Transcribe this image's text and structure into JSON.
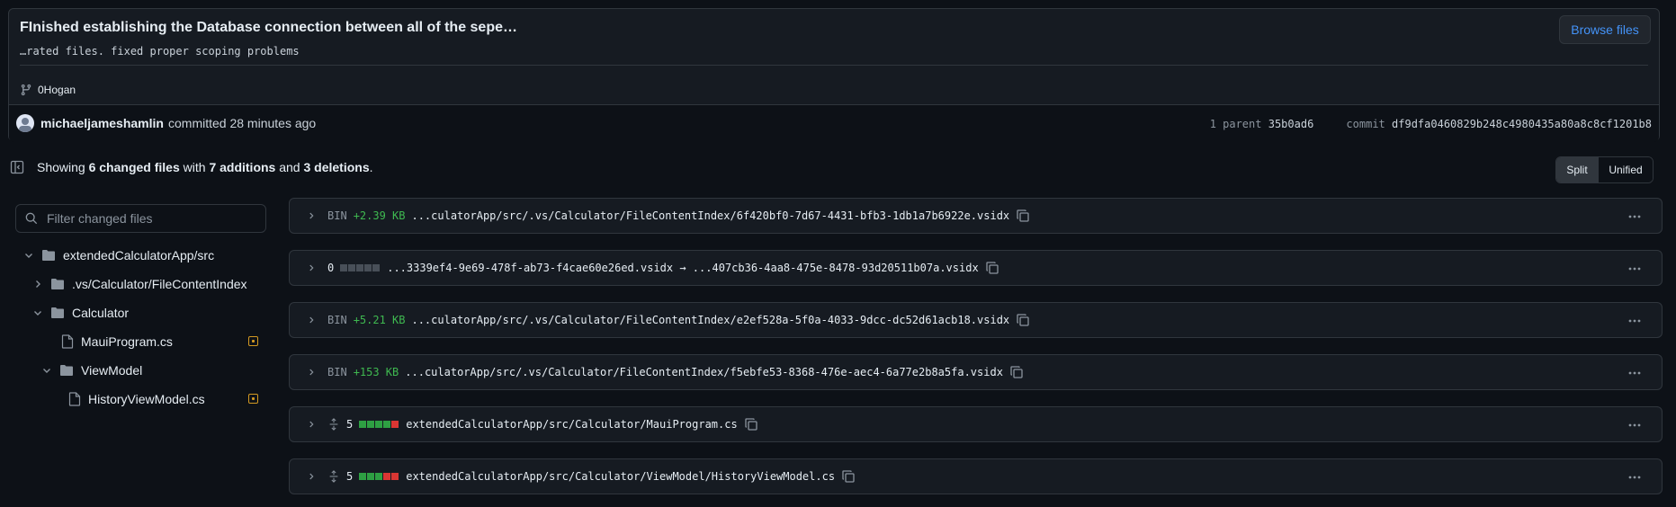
{
  "commit": {
    "title": "FInished establishing the Database connection between all of the sepe…",
    "body": "…rated files. fixed proper scoping problems",
    "browse_label": "Browse files",
    "branch": "0Hogan",
    "author": "michaeljameshamlin",
    "committed_text": "committed 28 minutes ago",
    "parent_label": "1 parent",
    "parent_sha": "35b0ad6",
    "commit_label": "commit",
    "commit_sha": "df9dfa0460829b248c4980435a80a8c8cf1201b8"
  },
  "summary": {
    "showing": "Showing",
    "changed_files": "6 changed files",
    "with": "with",
    "additions": "7 additions",
    "and": "and",
    "deletions": "3 deletions",
    "period": "."
  },
  "view_toggle": {
    "split": "Split",
    "unified": "Unified"
  },
  "filter": {
    "placeholder": "Filter changed files"
  },
  "tree": [
    {
      "label": "extendedCalculatorApp/src",
      "type": "folder",
      "expanded": true
    },
    {
      "label": ".vs/Calculator/FileContentIndex",
      "type": "folder",
      "expanded": false
    },
    {
      "label": "Calculator",
      "type": "folder",
      "expanded": true
    },
    {
      "label": "MauiProgram.cs",
      "type": "file",
      "status": "modified"
    },
    {
      "label": "ViewModel",
      "type": "folder",
      "expanded": true
    },
    {
      "label": "HistoryViewModel.cs",
      "type": "file",
      "status": "modified"
    }
  ],
  "files": [
    {
      "kind": "BIN",
      "delta": "+2.39 KB",
      "path": "...culatorApp/src/.vs/Calculator/FileContentIndex/6f420bf0-7d67-4431-bfb3-1db1a7b6922e.vsidx"
    },
    {
      "kind": "0",
      "delta": "",
      "path": "...3339ef4-9e69-478f-ab73-f4cae60e26ed.vsidx → ...407cb36-4aa8-475e-8478-93d20511b07a.vsidx"
    },
    {
      "kind": "BIN",
      "delta": "+5.21 KB",
      "path": "...culatorApp/src/.vs/Calculator/FileContentIndex/e2ef528a-5f0a-4033-9dcc-dc52d61acb18.vsidx"
    },
    {
      "kind": "BIN",
      "delta": "+153 KB",
      "path": "...culatorApp/src/.vs/Calculator/FileContentIndex/f5ebfe53-8368-476e-aec4-6a77e2b8a5fa.vsidx"
    },
    {
      "kind": "5",
      "delta": "",
      "path": "extendedCalculatorApp/src/Calculator/MauiProgram.cs"
    },
    {
      "kind": "5",
      "delta": "",
      "path": "extendedCalculatorApp/src/Calculator/ViewModel/HistoryViewModel.cs"
    }
  ],
  "colors": {
    "accent": "#4493f8",
    "added": "#3fb950",
    "deleted": "#da3633",
    "modified": "#d29922"
  }
}
